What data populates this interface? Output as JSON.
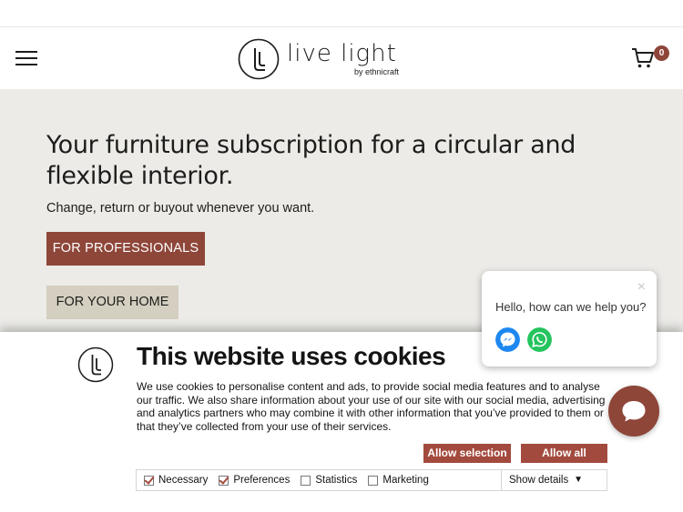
{
  "header": {
    "logo_title": "live light",
    "logo_subtitle": "by ethnicraft",
    "cart_count": "0"
  },
  "hero": {
    "title": "Your furniture subscription for a circular and flexible interior.",
    "subtitle": "Change, return or buyout whenever you want.",
    "btn_professionals": "FOR PROFESSIONALS",
    "btn_home": "FOR YOUR HOME"
  },
  "chat": {
    "greeting": "Hello, how can we help you?",
    "close": "×"
  },
  "cookie": {
    "title": "This website uses cookies",
    "text": "We use cookies to personalise content and ads, to provide social media features and to analyse our traffic. We also share information about your use of our site with our social media, advertising and analytics partners who may combine it with other information that you’ve provided to them or that they’ve collected from your use of their services.",
    "allow_selection": "Allow selection",
    "allow_all": "Allow all",
    "checkboxes": [
      {
        "label": "Necessary",
        "checked": true
      },
      {
        "label": "Preferences",
        "checked": true
      },
      {
        "label": "Statistics",
        "checked": false
      },
      {
        "label": "Marketing",
        "checked": false
      }
    ],
    "show_details": "Show details"
  },
  "colors": {
    "brand": "#8e4639",
    "hero_bg": "#ecebe8",
    "secondary_btn": "#d4cfc0",
    "cookie_btn": "#a34a3e",
    "messenger": "#1e88f0",
    "whatsapp": "#25c45e"
  }
}
